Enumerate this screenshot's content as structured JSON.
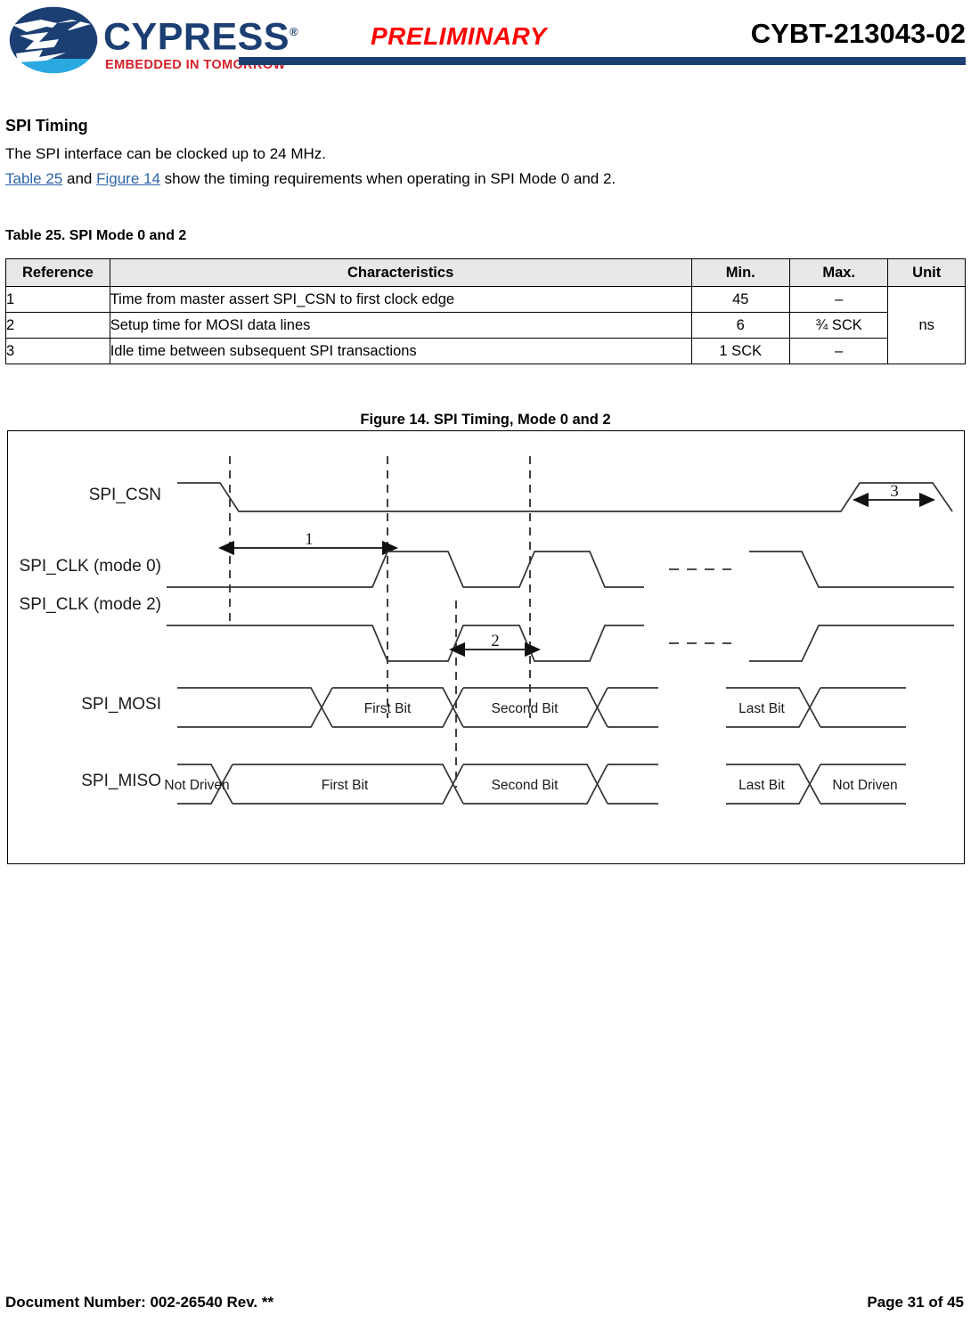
{
  "header": {
    "logo_word": "CYPRESS",
    "logo_registered": "®",
    "logo_tagline": "EMBEDDED IN TOMORROW",
    "logo_tm": "™",
    "status_stamp": "PRELIMINARY",
    "part_number": "CYBT-213043-02",
    "rule_color": "#1b3f72",
    "stamp_color": "#ff0000"
  },
  "content": {
    "section_title": "SPI Timing",
    "paragraph_1": "The SPI interface can be clocked up to 24 MHz.",
    "paragraph_2": {
      "link_table": "Table 25",
      "mid": " and ",
      "link_figure": "Figure 14",
      "tail": " show the timing requirements when operating in SPI Mode 0 and 2.",
      "link_color": "#2e64a8"
    }
  },
  "table": {
    "caption": "Table 25.  SPI Mode 0 and 2",
    "columns": [
      "Reference",
      "Characteristics",
      "Min.",
      "Max.",
      "Unit"
    ],
    "rows": [
      {
        "reference": "1",
        "characteristics": "Time from master assert SPI_CSN to first clock edge",
        "min": "45",
        "max": "–"
      },
      {
        "reference": "2",
        "characteristics": "Setup time for MOSI data lines",
        "min": "6",
        "max": "¾ SCK"
      },
      {
        "reference": "3",
        "characteristics": "Idle time between subsequent SPI transactions",
        "min": "1 SCK",
        "max": "–"
      }
    ],
    "unit_spanned": "ns",
    "header_bg": "#e8e8e8"
  },
  "figure": {
    "caption": "Figure 14.  SPI Timing, Mode 0 and 2",
    "signals": {
      "csn": "SPI_CSN",
      "clk_mode0": "SPI_CLK (mode 0)",
      "clk_mode2": "SPI_CLK (mode 2)",
      "mosi": "SPI_MOSI",
      "miso": "SPI_MISO"
    },
    "markers": {
      "m1": "1",
      "m2": "2",
      "m3": "3"
    },
    "mosi_segments": {
      "first_bit": "First Bit",
      "second_bit": "Second Bit",
      "last_bit": "Last Bit"
    },
    "miso_segments": {
      "not_driven_start": "Not Driven",
      "first_bit": "First Bit",
      "second_bit": "Second Bit",
      "last_bit": "Last Bit",
      "not_driven_end": "Not Driven"
    }
  },
  "footer": {
    "document_number": "Document Number: 002-26540 Rev. **",
    "page": "Page 31 of 45"
  }
}
